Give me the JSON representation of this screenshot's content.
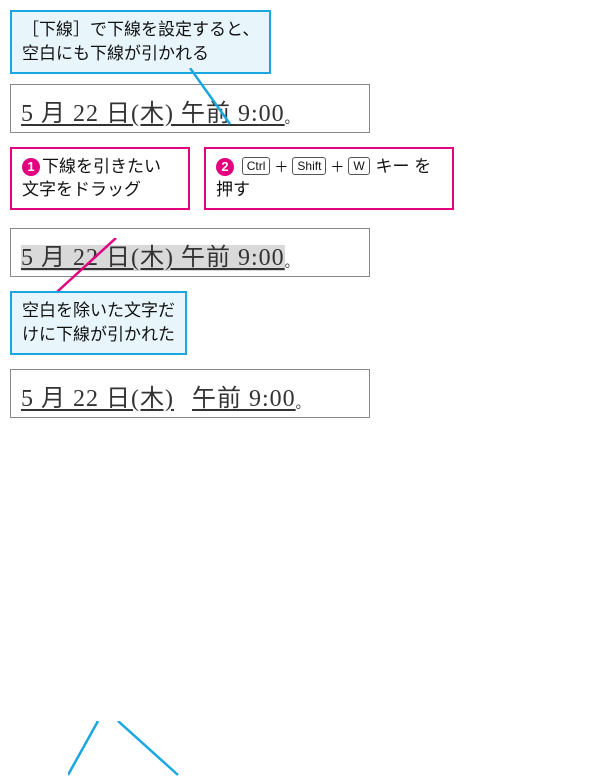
{
  "callout_top": {
    "line1": "［下線］で下線を設定すると、",
    "line2": "空白にも下線が引かれる"
  },
  "sample1": {
    "text": "5 月 22 日(木)   午前 9:00",
    "trailing": "。"
  },
  "step1": {
    "num": "1",
    "line1": "下線を引きたい",
    "line2": "文字をドラッグ"
  },
  "step2": {
    "num": "2",
    "keys": {
      "k1": "Ctrl",
      "k2": "Shift",
      "k3": "W"
    },
    "tail1": "キー を",
    "line2": "押す"
  },
  "sample2": {
    "text": "5 月 22 日(木)   午前 9:00",
    "trailing": "。"
  },
  "callout_bottom": {
    "line1": "空白を除いた文字だ",
    "line2": "けに下線が引かれた"
  },
  "sample3": {
    "part1": "5 月 22 日(木)",
    "part2": "午前 9:00",
    "trailing": "。"
  },
  "colors": {
    "blue": "#1aa7e0",
    "magenta": "#e3007f"
  }
}
